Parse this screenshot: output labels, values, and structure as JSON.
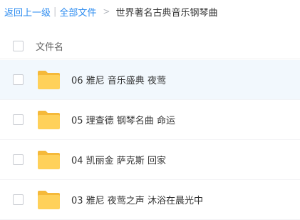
{
  "breadcrumb": {
    "back_label": "返回上一级",
    "separator": "|",
    "all_files_label": "全部文件",
    "arrow": ">",
    "current_label": "世界著名古典音乐钢琴曲"
  },
  "header": {
    "column_name_label": "文件名"
  },
  "files": [
    {
      "name": "06 雅尼 音乐盛典 夜莺",
      "type": "folder",
      "highlighted": true
    },
    {
      "name": "05 理查德 钢琴名曲 命运",
      "type": "folder",
      "highlighted": false
    },
    {
      "name": "04 凯丽金 萨克斯 回家",
      "type": "folder",
      "highlighted": false
    },
    {
      "name": "03 雅尼 夜莺之声 沐浴在晨光中",
      "type": "folder",
      "highlighted": false
    }
  ],
  "colors": {
    "link": "#2d8cf0",
    "folder": "#ffd15a",
    "folder_tab": "#f5b93a",
    "row_highlight": "#f2f8fd"
  },
  "icons": {
    "folder": "folder-icon"
  }
}
